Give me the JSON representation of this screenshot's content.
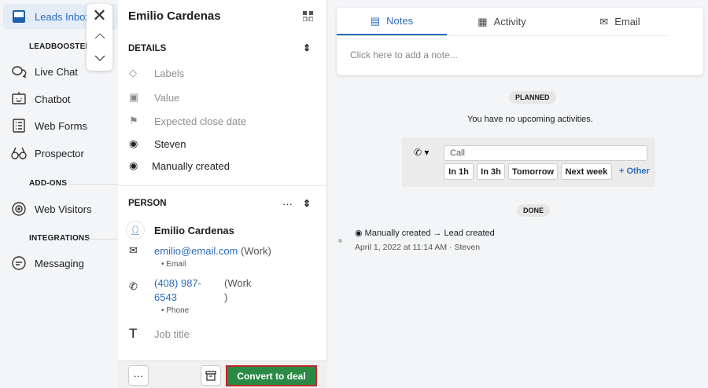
{
  "sidebar": {
    "active": {
      "label": "Leads Inbox",
      "icon": "inbox-icon"
    },
    "sections": [
      {
        "title": "LEADBOOSTER"
      },
      {
        "title": "ADD-ONS"
      },
      {
        "title": "INTEGRATIONS"
      }
    ],
    "items": [
      {
        "label": "Live Chat",
        "icon": "chat-icon"
      },
      {
        "label": "Chatbot",
        "icon": "bot-icon"
      },
      {
        "label": "Web Forms",
        "icon": "form-icon"
      },
      {
        "label": "Prospector",
        "icon": "binoculars-icon"
      },
      {
        "label": "Web Visitors",
        "icon": "visitors-icon"
      },
      {
        "label": "Messaging",
        "icon": "message-icon"
      }
    ]
  },
  "lead": {
    "title": "Emilio Cardenas",
    "details_title": "DETAILS",
    "details": {
      "labels": "Labels",
      "value": "Value",
      "close_date": "Expected close date",
      "owner": "Steven",
      "source": "Manually created"
    },
    "person_title": "PERSON",
    "person": {
      "name": "Emilio Cardenas",
      "email": "emilio@email.com",
      "email_type": "(Work)",
      "email_label": "Email",
      "phone_line1": "(408) 987-",
      "phone_line2": "6543",
      "phone_type1": "(Work",
      "phone_type2": ")",
      "phone_label": "Phone",
      "job_title": "Job title"
    },
    "footer": {
      "more": "···",
      "convert": "Convert to deal"
    }
  },
  "tabs": [
    {
      "label": "Notes",
      "icon": "note-icon",
      "active": true
    },
    {
      "label": "Activity",
      "icon": "calendar-icon"
    },
    {
      "label": "Email",
      "icon": "mail-icon"
    }
  ],
  "note_placeholder": "Click here to add a note...",
  "planned": {
    "badge": "PLANNED",
    "empty": "You have no upcoming activities.",
    "input_value": "Call",
    "buttons": [
      "In 1h",
      "In 3h",
      "Tomorrow",
      "Next week"
    ],
    "other": "+ Other"
  },
  "done": {
    "badge": "DONE",
    "event": "Manually created → Lead created",
    "meta": "April 1, 2022 at 11:14 AM · Steven"
  },
  "colors": {
    "accent": "#2a6dbb",
    "convert": "#2a8a45",
    "highlight": "#c62828"
  }
}
